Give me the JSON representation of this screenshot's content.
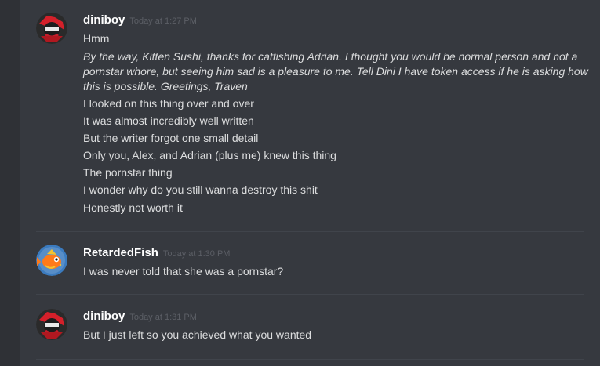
{
  "messages": [
    {
      "username": "diniboy",
      "timestamp": "Today at 1:27 PM",
      "lines": [
        "Hmm",
        "By the way, Kitten Sushi, thanks for catfishing Adrian. I thought you would be normal person and not a pornstar whore, but seeing him sad is a pleasure to me. Tell Dini I have token access if he is asking how this is possible. Greetings, Traven",
        "I looked on this thing over and over",
        "It was almost incredibly well written",
        "But the writer forgot one small detail",
        "Only you, Alex, and Adrian (plus me) knew this thing",
        "The pornstar thing",
        "I wonder why do you still wanna destroy this shit",
        "Honestly not worth it"
      ],
      "avatar_icon": "red-character-avatar-icon"
    },
    {
      "username": "RetardedFish",
      "timestamp": "Today at 1:30 PM",
      "lines": [
        "I was never told that she was a pornstar?"
      ],
      "avatar_icon": "magikarp-fish-avatar-icon"
    },
    {
      "username": "diniboy",
      "timestamp": "Today at 1:31 PM",
      "lines": [
        "But I just left so you achieved what you wanted"
      ],
      "avatar_icon": "red-character-avatar-icon"
    }
  ],
  "colors": {
    "background": "#36393f",
    "username": "#ffffff",
    "timestamp": "#5c5f66",
    "text": "#dcddde",
    "divider": "#40444b"
  }
}
